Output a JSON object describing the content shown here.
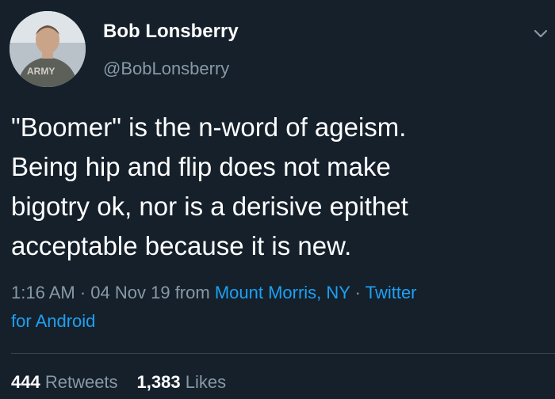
{
  "user": {
    "display_name": "Bob Lonsberry",
    "handle": "@BobLonsberry",
    "avatar_shirt_text": "ARMY"
  },
  "tweet": {
    "text_lines": [
      "\"Boomer\" is the n-word of ageism.",
      "Being hip and flip does not make",
      "bigotry ok, nor is a derisive epithet",
      "acceptable because it is new."
    ]
  },
  "meta": {
    "time": "1:16 AM",
    "separator": " · ",
    "date": "04 Nov 19",
    "from_word": " from ",
    "location": "Mount Morris, NY",
    "client_line1": "Twitter",
    "client_line2": "for Android"
  },
  "stats": {
    "retweets_count": "444",
    "retweets_label": " Retweets",
    "likes_count": "1,383",
    "likes_label": " Likes"
  },
  "colors": {
    "background": "#15202b",
    "text": "#ffffff",
    "secondary": "#8899a6",
    "link": "#1da1f2",
    "divider": "#38444d"
  },
  "icons": {
    "caret": "chevron-down-icon"
  }
}
